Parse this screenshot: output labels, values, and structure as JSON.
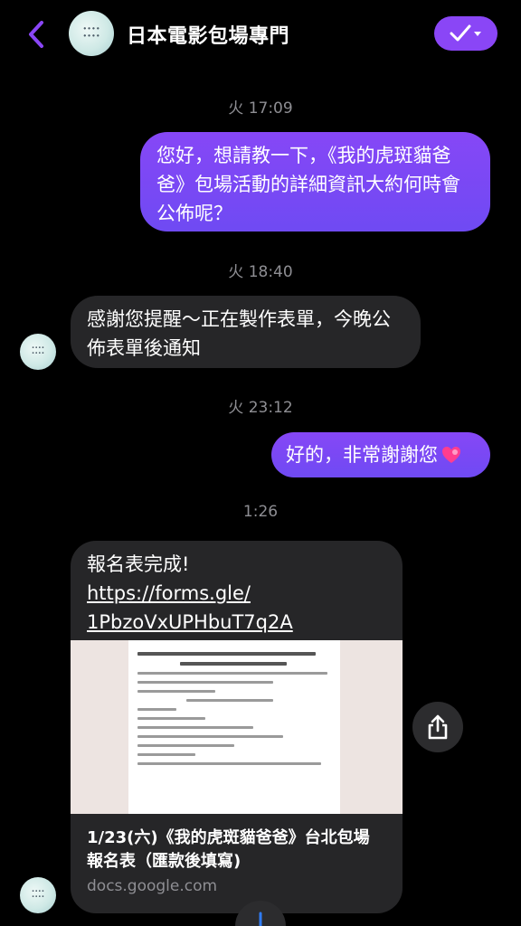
{
  "header": {
    "title": "日本電影包場專門",
    "avatar_text": "••••\n••••",
    "back_icon": "chevron-left-icon",
    "check_icon": "check-dropdown-icon",
    "accent": "#8a46f6"
  },
  "messages": [
    {
      "timestamp": "火 17:09"
    },
    {
      "outgoing_text": "您好，想請教一下，《我的虎斑貓爸爸》包場活動的詳細資訊大約何時會公佈呢？"
    },
    {
      "timestamp": "火 18:40"
    },
    {
      "incoming_text": "感謝您提醒～正在製作表單，今晚公佈表單後通知"
    },
    {
      "timestamp": "火 23:12"
    },
    {
      "outgoing_text": "好的，非常謝謝您",
      "emoji": "heart-emoji"
    },
    {
      "timestamp": "1:26"
    },
    {
      "incoming_text": "報名表完成!",
      "link_line1": "https://forms.gle/",
      "link_line2": "1PbzoVxUPHbuT7q2A",
      "preview_title": "1/23(六)《我的虎斑貓爸爸》台北包場報名表（匯款後填寫)",
      "preview_domain": "docs.google.com"
    }
  ],
  "actions": {
    "share_icon": "share-icon",
    "scroll_icon": "arrow-down-icon"
  }
}
